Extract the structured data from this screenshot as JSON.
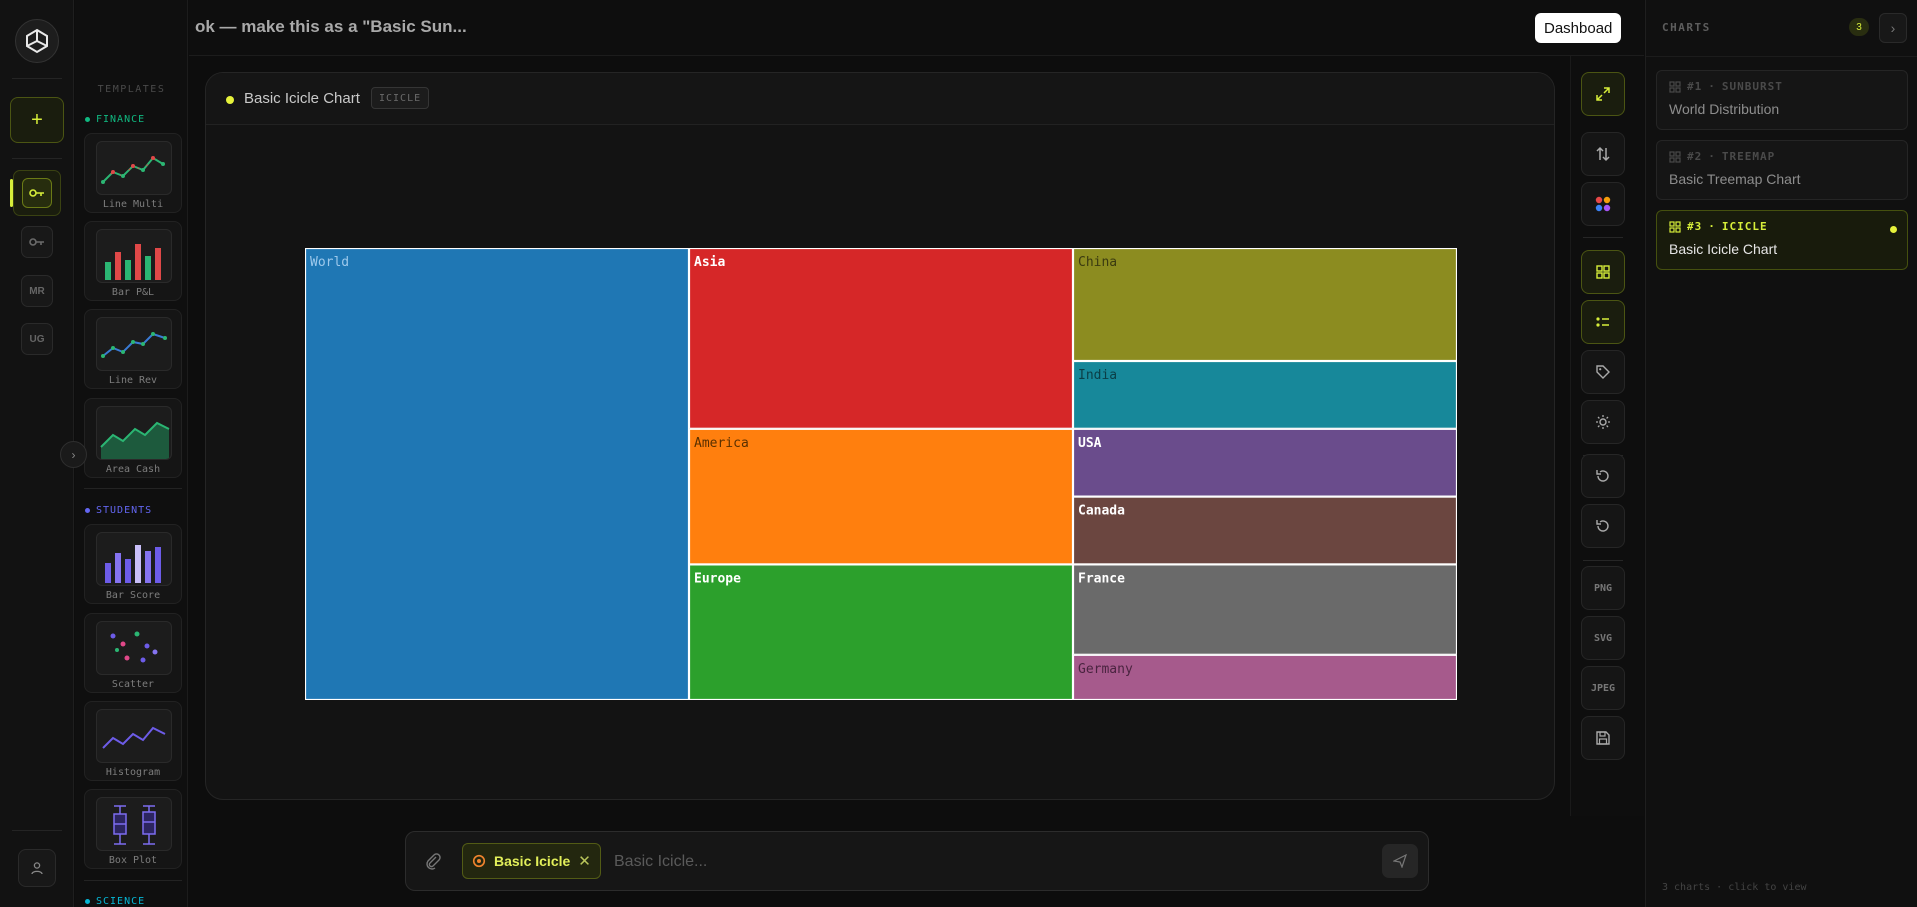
{
  "header": {
    "conversation_title": "ok — make this as a \"Basic Sun...",
    "dashboard_button": "Dashboad"
  },
  "rail": {
    "new_button": "+",
    "workspaces": [
      {
        "id": "ws-key-active",
        "icon": "key-icon",
        "label": ""
      },
      {
        "id": "ws-key",
        "icon": "key-icon",
        "label": ""
      },
      {
        "id": "ws-mr",
        "icon": "",
        "label": "MR"
      },
      {
        "id": "ws-ug",
        "icon": "",
        "label": "UG"
      }
    ]
  },
  "templates": {
    "title": "TEMPLATES",
    "categories": [
      {
        "name": "FINANCE",
        "color": "#10b981",
        "items": [
          "Line Multi",
          "Bar P&L",
          "Line Rev",
          "Area Cash"
        ]
      },
      {
        "name": "STUDENTS",
        "color": "#6366f1",
        "items": [
          "Bar Score",
          "Scatter",
          "Histogram",
          "Box Plot"
        ]
      },
      {
        "name": "SCIENCE",
        "color": "#06b6d4",
        "items": []
      }
    ]
  },
  "canvas": {
    "chart_title": "Basic Icicle Chart",
    "chart_badge": "ICICLE"
  },
  "chart_data": {
    "type": "icicle",
    "root": "World",
    "nodes": [
      {
        "label": "World",
        "parent": "",
        "value": 100,
        "color": "#1f77b4",
        "label_color": "#9ec9ec"
      },
      {
        "label": "Asia",
        "parent": "World",
        "value": 40,
        "color": "#d62728",
        "label_color": "#ffffff"
      },
      {
        "label": "America",
        "parent": "World",
        "value": 30,
        "color": "#ff7f0e",
        "label_color": "#5a3000"
      },
      {
        "label": "Europe",
        "parent": "World",
        "value": 30,
        "color": "#2ca02c",
        "label_color": "#ffffff"
      },
      {
        "label": "China",
        "parent": "Asia",
        "value": 25,
        "color": "#8c8c20",
        "label_color": "#3a3a10"
      },
      {
        "label": "India",
        "parent": "Asia",
        "value": 15,
        "color": "#17889a",
        "label_color": "#0b3e46"
      },
      {
        "label": "USA",
        "parent": "America",
        "value": 15,
        "color": "#6a4c8c",
        "label_color": "#ffffff"
      },
      {
        "label": "Canada",
        "parent": "America",
        "value": 15,
        "color": "#6b4640",
        "label_color": "#ffffff"
      },
      {
        "label": "France",
        "parent": "Europe",
        "value": 20,
        "color": "#6a6a6a",
        "label_color": "#ffffff"
      },
      {
        "label": "Germany",
        "parent": "Europe",
        "value": 10,
        "color": "#a65a8c",
        "label_color": "#4a2440"
      }
    ]
  },
  "tools": {
    "export": [
      "PNG",
      "SVG",
      "JPEG"
    ]
  },
  "input": {
    "chip_label": "Basic Icicle",
    "placeholder": "Basic Icicle..."
  },
  "charts_panel": {
    "title": "CHARTS",
    "count": "3",
    "items": [
      {
        "number": "#1",
        "type": "SUNBURST",
        "name": "World Distribution",
        "active": false
      },
      {
        "number": "#2",
        "type": "TREEMAP",
        "name": "Basic Treemap Chart",
        "active": false
      },
      {
        "number": "#3",
        "type": "ICICLE",
        "name": "Basic Icicle Chart",
        "active": true
      }
    ],
    "footer": "3 charts · click to view"
  }
}
